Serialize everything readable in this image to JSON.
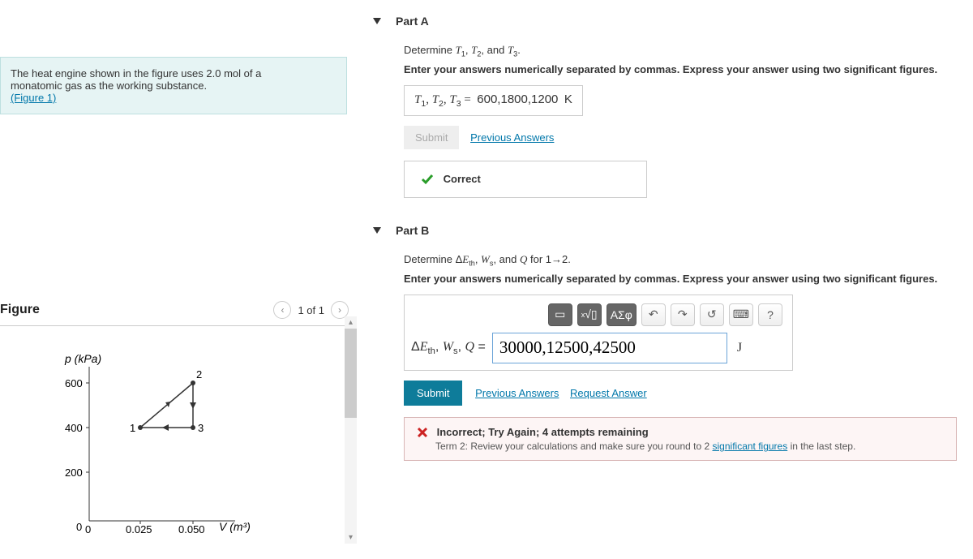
{
  "problem": {
    "text_line1": "The heat engine shown in the figure uses 2.0 mol of a",
    "text_line2": "monatomic gas as the working substance.",
    "figure_link": "(Figure 1)"
  },
  "figure": {
    "title": "Figure",
    "nav_text": "1 of 1",
    "y_label": "p (kPa)",
    "x_label": "V (m³)",
    "y_ticks": [
      "600",
      "400",
      "200",
      "0"
    ],
    "x_ticks": [
      "0",
      "0.025",
      "0.050"
    ]
  },
  "chart_data": {
    "type": "line",
    "title": "",
    "xlabel": "V (m³)",
    "ylabel": "p (kPa)",
    "xlim": [
      0,
      0.06
    ],
    "ylim": [
      0,
      650
    ],
    "x_ticks": [
      0,
      0.025,
      0.05
    ],
    "y_ticks": [
      0,
      200,
      400,
      600
    ],
    "points": [
      {
        "label": "1",
        "V": 0.025,
        "p": 400
      },
      {
        "label": "2",
        "V": 0.05,
        "p": 600
      },
      {
        "label": "3",
        "V": 0.05,
        "p": 400
      }
    ],
    "cycle_edges": [
      {
        "from": "1",
        "to": "2"
      },
      {
        "from": "2",
        "to": "3"
      },
      {
        "from": "3",
        "to": "1"
      }
    ],
    "annotations": [
      "arrows indicate cycle direction 1→2→3→1"
    ]
  },
  "partA": {
    "header": "Part A",
    "question_prefix": "Determine ",
    "question_vars": "T₁, T₂, and T₃",
    "question_suffix": ".",
    "instruction": "Enter your answers numerically separated by commas. Express your answer using two significant figures.",
    "answer_label": "T₁, T₂, T₃ = ",
    "answer_value": "600,1800,1200",
    "answer_unit": "K",
    "submit_label": "Submit",
    "prev_answers": "Previous Answers",
    "feedback": "Correct"
  },
  "partB": {
    "header": "Part B",
    "question_prefix": "Determine ",
    "question_vars_html": "ΔEₜₕ, Wₛ, and Q for 1→2.",
    "instruction": "Enter your answers numerically separated by commas. Express your answer using two significant figures.",
    "toolbar_math": "ΑΣφ",
    "toolbar_help": "?",
    "answer_label_html": "ΔEₜₕ, Wₛ, Q = ",
    "answer_value": "30000,12500,42500",
    "answer_unit": "J",
    "submit_label": "Submit",
    "prev_answers": "Previous Answers",
    "request_answer": "Request Answer",
    "feedback_title": "Incorrect; Try Again; 4 attempts remaining",
    "feedback_sub_prefix": "Term 2: Review your calculations and make sure you round to 2 ",
    "feedback_sub_link": "significant figures",
    "feedback_sub_suffix": " in the last step."
  }
}
